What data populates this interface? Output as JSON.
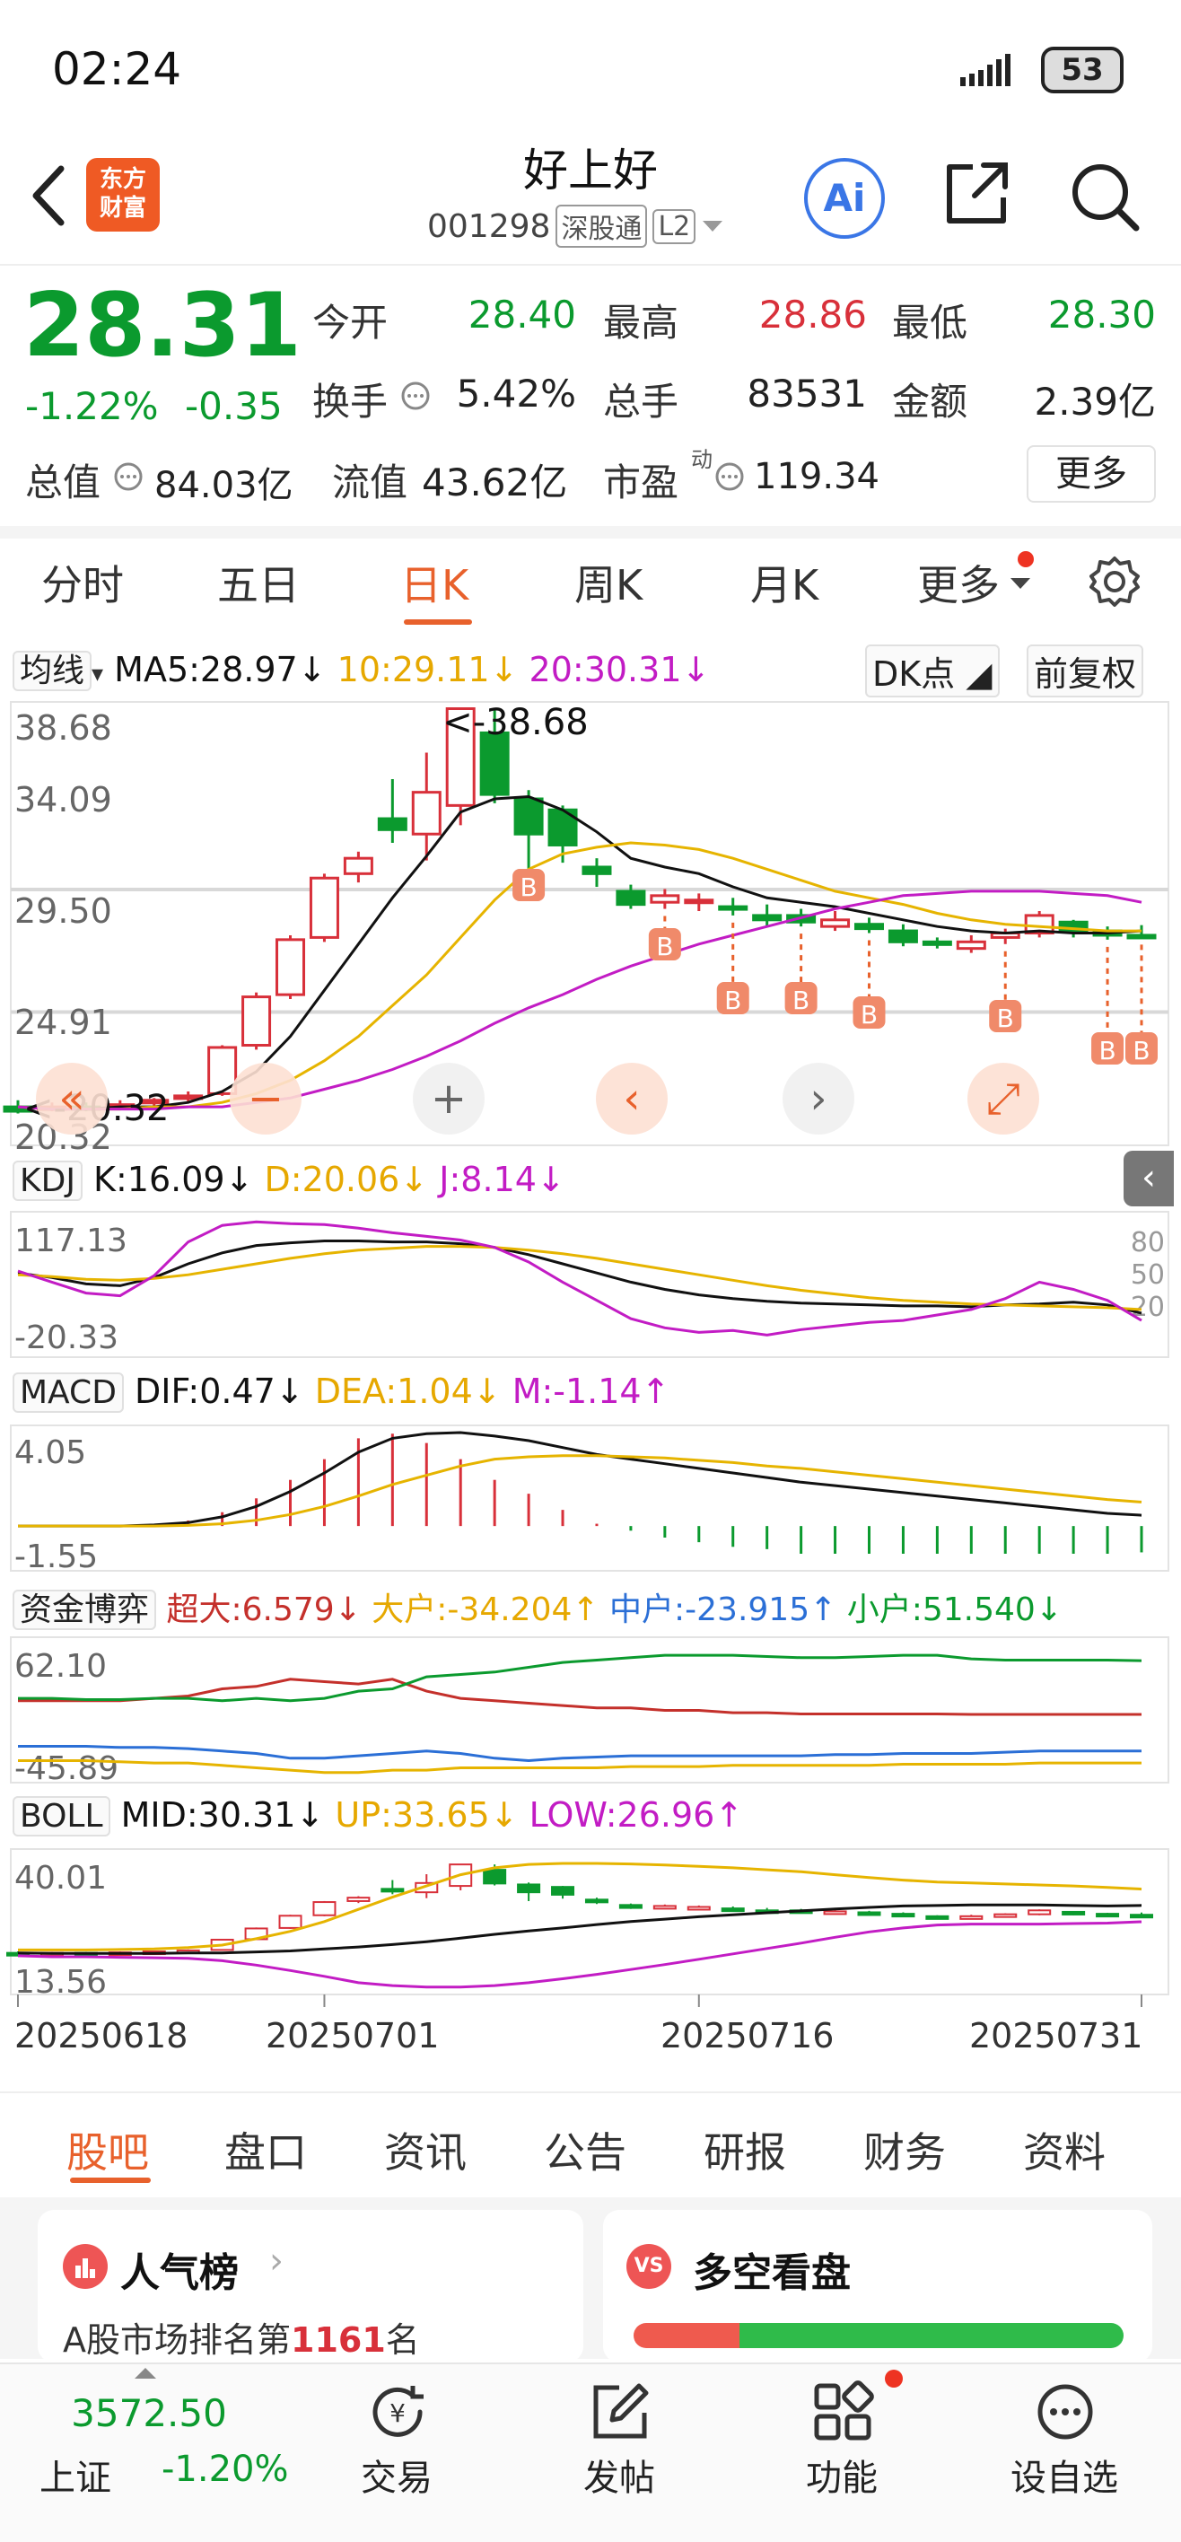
{
  "status_bar": {
    "time": "02:24",
    "battery": "53"
  },
  "header": {
    "logo_text_1": "东方",
    "logo_text_2": "财富",
    "stock_name": "好上好",
    "stock_code": "001298",
    "exchange_tag": "深股通",
    "level_tag": "L2",
    "ai_label": "Ai"
  },
  "quote": {
    "price": "28.31",
    "change_pct": "-1.22%",
    "change": "-0.35",
    "fields": [
      {
        "label": "今开",
        "value": "28.40"
      },
      {
        "label": "最高",
        "value": "28.86"
      },
      {
        "label": "最低",
        "value": "28.30"
      },
      {
        "label": "换手",
        "value": "5.42%"
      },
      {
        "label": "总手",
        "value": "83531"
      },
      {
        "label": "金额",
        "value": "2.39亿"
      },
      {
        "label": "总值",
        "value": "84.03亿"
      },
      {
        "label": "流值",
        "value": "43.62亿"
      },
      {
        "label": "市盈",
        "value": "119.34"
      }
    ],
    "pe_superscript": "动",
    "more_label": "更多"
  },
  "period_tabs": [
    "分时",
    "五日",
    "日K",
    "周K",
    "月K",
    "更多"
  ],
  "colors": {
    "up": "#d8303a",
    "down": "#0b9a2e",
    "accent": "#e8612c",
    "ma5": "#111111",
    "ma10": "#e6a800",
    "ma20": "#c21cc4"
  },
  "chart_data": [
    {
      "type": "line",
      "title": "日K",
      "dates": [
        "20250618",
        "20250701",
        "20250716",
        "20250731"
      ],
      "price_axis": [
        "38.68",
        "34.09",
        "29.50",
        "24.91",
        "20.32"
      ],
      "high_label": "38.68",
      "low_label": "20.32",
      "candles": [
        {
          "o": 20.6,
          "c": 20.4,
          "h": 20.9,
          "l": 20.3
        },
        {
          "o": 20.5,
          "c": 20.6,
          "h": 20.8,
          "l": 20.4
        },
        {
          "o": 20.6,
          "c": 20.5,
          "h": 20.8,
          "l": 20.4
        },
        {
          "o": 20.6,
          "c": 20.7,
          "h": 20.9,
          "l": 20.5
        },
        {
          "o": 20.8,
          "c": 20.9,
          "h": 21.0,
          "l": 20.6
        },
        {
          "o": 21.0,
          "c": 21.1,
          "h": 21.3,
          "l": 20.8
        },
        {
          "o": 21.2,
          "c": 23.3,
          "h": 23.4,
          "l": 21.1
        },
        {
          "o": 23.4,
          "c": 25.6,
          "h": 25.8,
          "l": 23.2
        },
        {
          "o": 25.7,
          "c": 28.2,
          "h": 28.4,
          "l": 25.5
        },
        {
          "o": 28.3,
          "c": 31.0,
          "h": 31.2,
          "l": 28.1
        },
        {
          "o": 31.2,
          "c": 31.9,
          "h": 32.2,
          "l": 30.8
        },
        {
          "o": 33.7,
          "c": 33.2,
          "h": 35.5,
          "l": 32.6
        },
        {
          "o": 33.0,
          "c": 34.9,
          "h": 36.7,
          "l": 31.8
        },
        {
          "o": 34.3,
          "c": 38.7,
          "h": 38.7,
          "l": 33.4
        },
        {
          "o": 37.6,
          "c": 34.8,
          "h": 38.7,
          "l": 34.4
        },
        {
          "o": 34.6,
          "c": 33.0,
          "h": 35.0,
          "l": 31.2
        },
        {
          "o": 34.1,
          "c": 32.5,
          "h": 34.3,
          "l": 31.7
        },
        {
          "o": 31.5,
          "c": 31.2,
          "h": 31.9,
          "l": 30.6
        },
        {
          "o": 30.4,
          "c": 29.8,
          "h": 30.7,
          "l": 29.6
        },
        {
          "o": 29.9,
          "c": 30.2,
          "h": 30.5,
          "l": 29.6
        },
        {
          "o": 30.0,
          "c": 30.0,
          "h": 30.3,
          "l": 29.5
        },
        {
          "o": 29.7,
          "c": 29.6,
          "h": 30.1,
          "l": 29.3
        },
        {
          "o": 29.3,
          "c": 29.1,
          "h": 29.8,
          "l": 28.8
        },
        {
          "o": 29.3,
          "c": 29.0,
          "h": 29.6,
          "l": 28.8
        },
        {
          "o": 28.8,
          "c": 29.1,
          "h": 29.5,
          "l": 28.6
        },
        {
          "o": 28.9,
          "c": 28.7,
          "h": 29.2,
          "l": 28.5
        },
        {
          "o": 28.6,
          "c": 28.1,
          "h": 28.9,
          "l": 27.9
        },
        {
          "o": 28.1,
          "c": 28.0,
          "h": 28.3,
          "l": 27.8
        },
        {
          "o": 27.8,
          "c": 28.1,
          "h": 28.4,
          "l": 27.6
        },
        {
          "o": 28.3,
          "c": 28.5,
          "h": 28.7,
          "l": 28.0
        },
        {
          "o": 28.5,
          "c": 29.3,
          "h": 29.5,
          "l": 28.3
        },
        {
          "o": 29.0,
          "c": 28.6,
          "h": 29.1,
          "l": 28.3
        },
        {
          "o": 28.6,
          "c": 28.4,
          "h": 28.8,
          "l": 28.2
        },
        {
          "o": 28.4,
          "c": 28.31,
          "h": 28.86,
          "l": 28.3
        }
      ],
      "ma": {
        "ma5": [
          20.6,
          20.5,
          20.5,
          20.6,
          20.6,
          20.8,
          21.3,
          22.2,
          23.8,
          25.9,
          28.0,
          30.1,
          32.0,
          34.0,
          34.6,
          34.7,
          34.1,
          33.1,
          31.9,
          31.5,
          31.2,
          30.6,
          30.1,
          29.9,
          29.7,
          29.4,
          29.1,
          28.8,
          28.6,
          28.5,
          28.6,
          28.5,
          28.5,
          28.6
        ],
        "ma10": [
          20.6,
          20.5,
          20.5,
          20.5,
          20.6,
          20.6,
          20.8,
          21.2,
          21.8,
          22.7,
          23.8,
          25.2,
          26.6,
          28.3,
          30.0,
          31.4,
          32.1,
          32.4,
          32.6,
          32.5,
          32.3,
          31.9,
          31.4,
          30.9,
          30.4,
          30.1,
          29.8,
          29.4,
          29.1,
          28.9,
          28.8,
          28.7,
          28.6,
          28.6
        ],
        "ma20": [
          20.6,
          20.5,
          20.5,
          20.5,
          20.5,
          20.6,
          20.6,
          20.8,
          21.0,
          21.4,
          21.8,
          22.3,
          22.9,
          23.6,
          24.4,
          25.1,
          25.7,
          26.4,
          27.0,
          27.5,
          28.0,
          28.4,
          28.8,
          29.2,
          29.6,
          29.9,
          30.2,
          30.3,
          30.4,
          30.4,
          30.4,
          30.3,
          30.2,
          29.9
        ]
      },
      "legend": {
        "ma5": "MA5:28.97",
        "ma10": "10:29.11",
        "ma20": "20:30.31"
      },
      "ma_selector": "均线",
      "dk_label": "DK点",
      "adjust_label": "前复权",
      "b_markers": [
        15,
        19,
        21,
        23,
        25,
        29,
        32,
        33
      ],
      "b_label": "B"
    },
    {
      "type": "line",
      "title": "KDJ",
      "axis": [
        "117.13",
        "-20.33"
      ],
      "ref_levels": [
        "80",
        "50",
        "20"
      ],
      "legend": {
        "k": "K:16.09",
        "d": "D:20.06",
        "j": "J:8.14"
      },
      "k": [
        60,
        55,
        48,
        46,
        55,
        70,
        82,
        90,
        93,
        95,
        95,
        94,
        94,
        92,
        88,
        80,
        70,
        60,
        50,
        42,
        36,
        32,
        29,
        27,
        26,
        25,
        24,
        24,
        23,
        25,
        26,
        28,
        25,
        16
      ],
      "d": [
        58,
        56,
        53,
        52,
        54,
        58,
        64,
        70,
        76,
        81,
        85,
        87,
        89,
        89,
        88,
        85,
        81,
        76,
        70,
        64,
        58,
        52,
        46,
        41,
        37,
        33,
        30,
        28,
        26,
        25,
        24,
        23,
        22,
        20
      ],
      "j": [
        62,
        50,
        38,
        35,
        57,
        94,
        112,
        116,
        114,
        113,
        109,
        104,
        100,
        96,
        88,
        72,
        50,
        30,
        10,
        0,
        -5,
        -3,
        -8,
        -2,
        2,
        6,
        8,
        14,
        20,
        32,
        50,
        42,
        30,
        8
      ]
    },
    {
      "type": "bar",
      "title": "MACD",
      "axis": [
        "4.05",
        "-1.55"
      ],
      "legend": {
        "dif": "DIF:0.47",
        "dea": "DEA:1.04",
        "m": "M:-1.14"
      },
      "dif": [
        0,
        0,
        0,
        0,
        0.05,
        0.15,
        0.4,
        0.85,
        1.5,
        2.3,
        3.2,
        3.8,
        4.0,
        4.05,
        3.9,
        3.7,
        3.4,
        3.1,
        2.9,
        2.7,
        2.5,
        2.3,
        2.1,
        1.9,
        1.75,
        1.6,
        1.45,
        1.3,
        1.15,
        1.0,
        0.85,
        0.7,
        0.55,
        0.47
      ],
      "dea": [
        0,
        0,
        0,
        0,
        0,
        0.03,
        0.1,
        0.25,
        0.5,
        0.85,
        1.3,
        1.8,
        2.2,
        2.6,
        2.9,
        3.0,
        3.05,
        3.05,
        3.0,
        2.95,
        2.85,
        2.75,
        2.6,
        2.5,
        2.35,
        2.2,
        2.05,
        1.9,
        1.75,
        1.6,
        1.45,
        1.3,
        1.15,
        1.04
      ],
      "m": [
        0,
        0,
        0,
        0,
        0.1,
        0.24,
        0.6,
        1.2,
        2.0,
        2.9,
        3.8,
        4.0,
        3.6,
        2.9,
        2.0,
        1.4,
        0.7,
        0.1,
        -0.2,
        -0.5,
        -0.7,
        -0.9,
        -1.0,
        -1.2,
        -1.2,
        -1.2,
        -1.2,
        -1.2,
        -1.2,
        -1.2,
        -1.2,
        -1.2,
        -1.2,
        -1.14
      ]
    },
    {
      "type": "line",
      "title": "资金博弈",
      "axis": [
        "62.10",
        "-45.89"
      ],
      "legend": {
        "super": "超大:6.579",
        "big": "大户:-34.204",
        "mid": "中户:-23.915",
        "small": "小户:51.540"
      },
      "super": [
        18,
        18,
        18,
        18,
        20,
        22,
        28,
        30,
        36,
        34,
        32,
        36,
        26,
        20,
        18,
        16,
        14,
        12,
        12,
        10,
        10,
        8,
        8,
        7,
        7,
        7,
        7,
        7,
        6.6,
        6.6,
        6.6,
        6.6,
        6.6,
        6.6
      ],
      "big": [
        -32,
        -32,
        -32,
        -33,
        -34,
        -34,
        -36,
        -38,
        -40,
        -42,
        -42,
        -40,
        -40,
        -38,
        -38,
        -38,
        -38,
        -38,
        -37,
        -37,
        -37,
        -36,
        -36,
        -36,
        -36,
        -36,
        -35,
        -35,
        -35,
        -35,
        -34,
        -34,
        -34,
        -34
      ],
      "mid": [
        -20,
        -20,
        -20,
        -21,
        -21,
        -22,
        -24,
        -26,
        -30,
        -30,
        -28,
        -26,
        -24,
        -26,
        -30,
        -32,
        -30,
        -29,
        -28,
        -28,
        -28,
        -28,
        -28,
        -28,
        -27,
        -27,
        -26,
        -26,
        -26,
        -25,
        -24,
        -24,
        -24,
        -24
      ],
      "small": [
        20,
        20,
        19,
        19,
        20,
        20,
        18,
        20,
        18,
        20,
        26,
        28,
        38,
        40,
        42,
        46,
        50,
        52,
        54,
        56,
        56,
        56,
        55,
        54,
        54,
        55,
        56,
        56,
        53,
        52,
        52,
        52,
        52,
        51.5
      ]
    },
    {
      "type": "line",
      "title": "BOLL",
      "axis": [
        "40.01",
        "13.56"
      ],
      "legend": {
        "mid": "MID:30.31",
        "up": "UP:33.65",
        "low": "LOW:26.96"
      },
      "mid": [
        20.6,
        20.5,
        20.5,
        20.5,
        20.5,
        20.6,
        20.6,
        20.8,
        21.0,
        21.4,
        21.8,
        22.3,
        22.9,
        23.6,
        24.4,
        25.1,
        25.7,
        26.4,
        27.0,
        27.5,
        28.0,
        28.4,
        28.8,
        29.2,
        29.6,
        29.9,
        30.2,
        30.3,
        30.4,
        30.4,
        30.4,
        30.3,
        30.2,
        30.31
      ],
      "up": [
        21.2,
        21.2,
        21.2,
        21.3,
        21.4,
        21.7,
        22.2,
        23.5,
        25.0,
        27.0,
        29.5,
        32.0,
        34.3,
        36.6,
        38.0,
        38.7,
        38.9,
        38.9,
        38.8,
        38.6,
        38.3,
        38.0,
        37.6,
        37.2,
        36.6,
        36.0,
        35.5,
        35.1,
        34.9,
        34.7,
        34.5,
        34.3,
        34.0,
        33.65
      ],
      "low": [
        20.0,
        19.8,
        19.8,
        19.7,
        19.6,
        19.5,
        19.0,
        18.1,
        17.0,
        15.8,
        14.5,
        13.9,
        13.6,
        13.6,
        13.9,
        14.5,
        15.3,
        16.2,
        17.2,
        18.2,
        19.3,
        20.4,
        21.5,
        22.6,
        23.8,
        24.9,
        25.7,
        26.3,
        26.5,
        26.5,
        26.5,
        26.6,
        26.7,
        26.96
      ]
    }
  ],
  "sub_tabs": [
    "股吧",
    "盘口",
    "资讯",
    "公告",
    "研报",
    "财务",
    "资料"
  ],
  "cards": {
    "rank_title": "人气榜",
    "rank_text_prefix": "A股市场排名第",
    "rank_number": "1161",
    "rank_suffix": "名",
    "vs_title": "多空看盘",
    "vs_icon": "VS",
    "bull_ratio": 0.216
  },
  "bottom_nav": {
    "index_value": "3572.50",
    "index_name": "上证",
    "index_change": "-1.20%",
    "items": [
      "交易",
      "发帖",
      "功能",
      "设自选"
    ]
  }
}
